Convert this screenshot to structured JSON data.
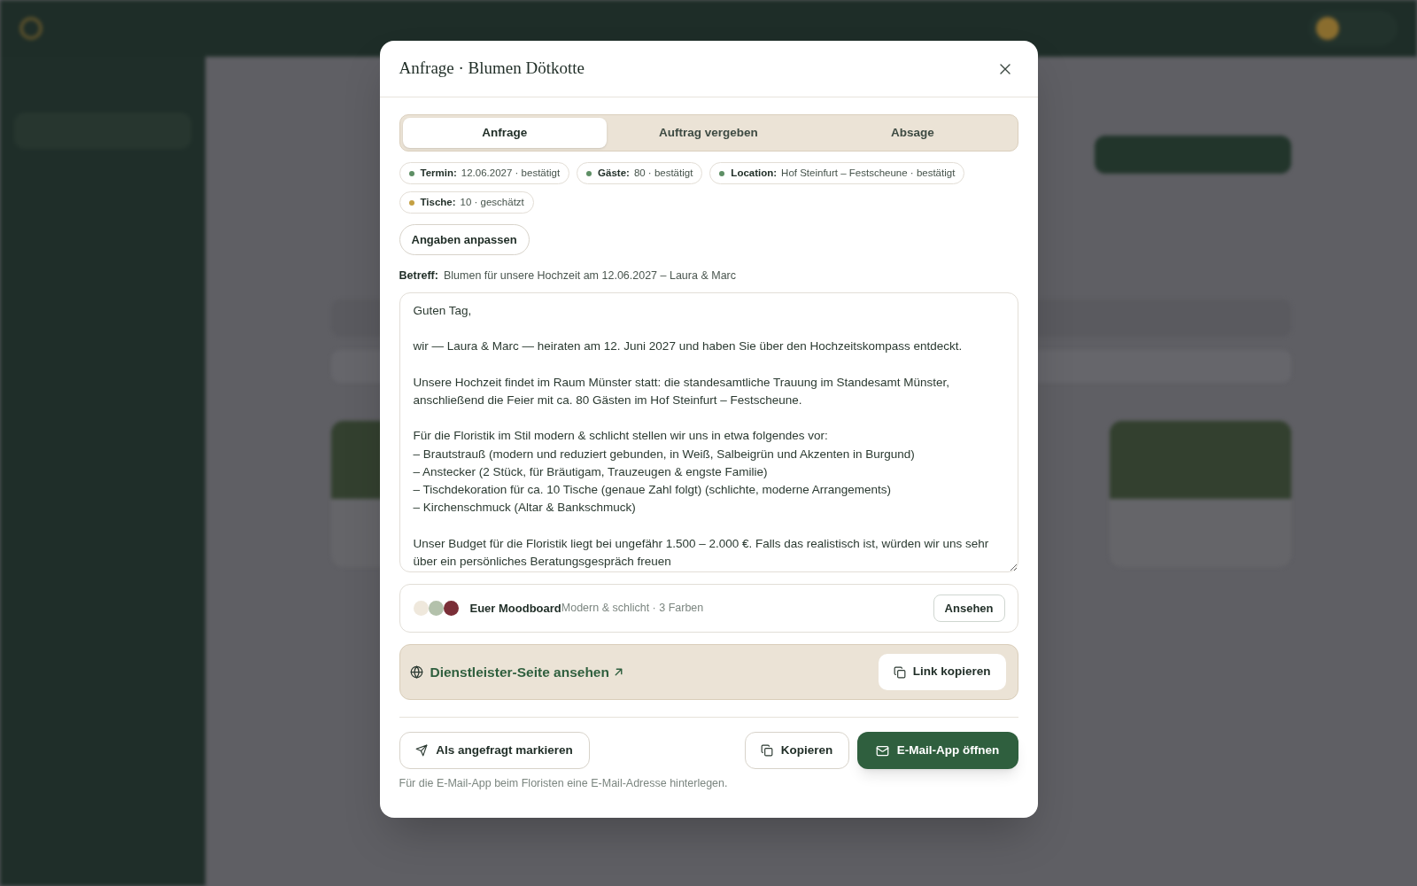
{
  "dialog": {
    "title": "Anfrage · Blumen Dötkotte",
    "tabs": [
      {
        "label": "Anfrage",
        "selected": true
      },
      {
        "label": "Auftrag vergeben",
        "selected": false
      },
      {
        "label": "Absage",
        "selected": false
      }
    ],
    "facts": [
      {
        "label": "Termin:",
        "value": "12.06.2027 · bestätigt",
        "color": "#5e8f65"
      },
      {
        "label": "Gäste:",
        "value": "80 · bestätigt",
        "color": "#5e8f65"
      },
      {
        "label": "Location:",
        "value": "Hof Steinfurt – Festscheune · bestätigt",
        "color": "#5e8f65"
      },
      {
        "label": "Tische:",
        "value": "10 · geschätzt",
        "color": "#c4a043"
      }
    ],
    "edit_button": "Angaben anpassen",
    "subject": {
      "label": "Betreff:",
      "value": "Blumen für unsere Hochzeit am 12.06.2027 – Laura & Marc"
    },
    "message": {
      "value": "Guten Tag,\n\nwir — Laura & Marc — heiraten am 12. Juni 2027 und haben Sie über den Hochzeitskompass entdeckt.\n\nUnsere Hochzeit findet im Raum Münster statt: die standesamtliche Trauung im Standesamt Münster,\nanschließend die Feier mit ca. 80 Gästen im Hof Steinfurt – Festscheune.\n\nFür die Floristik im Stil modern & schlicht stellen wir uns in etwa folgendes vor:\n– Brautstrauß (modern und reduziert gebunden, in Weiß, Salbeigrün und Akzenten in Burgund)\n– Anstecker (2 Stück, für Bräutigam, Trauzeugen & engste Familie)\n– Tischdekoration für ca. 10 Tische (genaue Zahl folgt) (schlichte, moderne Arrangements)\n– Kirchenschmuck (Altar & Bankschmuck)\n\nUnser Budget für die Floristik liegt bei ungefähr 1.500 – 2.000 €. Falls das realistisch ist, würden wir uns sehr\nüber ein persönliches Beratungsgespräch freuen"
    },
    "moodboard": {
      "title": "Euer Moodboard",
      "subtitle": "Modern & schlicht · 3 Farben",
      "swatches": [
        {
          "color": "#efe8dc"
        },
        {
          "color": "#b3c1ab"
        },
        {
          "color": "#7a2e37"
        }
      ],
      "button": "Ansehen"
    },
    "vendor_link": {
      "label": "Dienstleister-Seite ansehen",
      "copy_button": "Link kopieren"
    },
    "actions": {
      "mark_requested": "Als angefragt markieren",
      "copy": "Kopieren",
      "open_email": "E-Mail-App öffnen"
    },
    "hint": "Für die E-Mail-App beim Floristen eine E-Mail-Adresse hinterlegen."
  }
}
